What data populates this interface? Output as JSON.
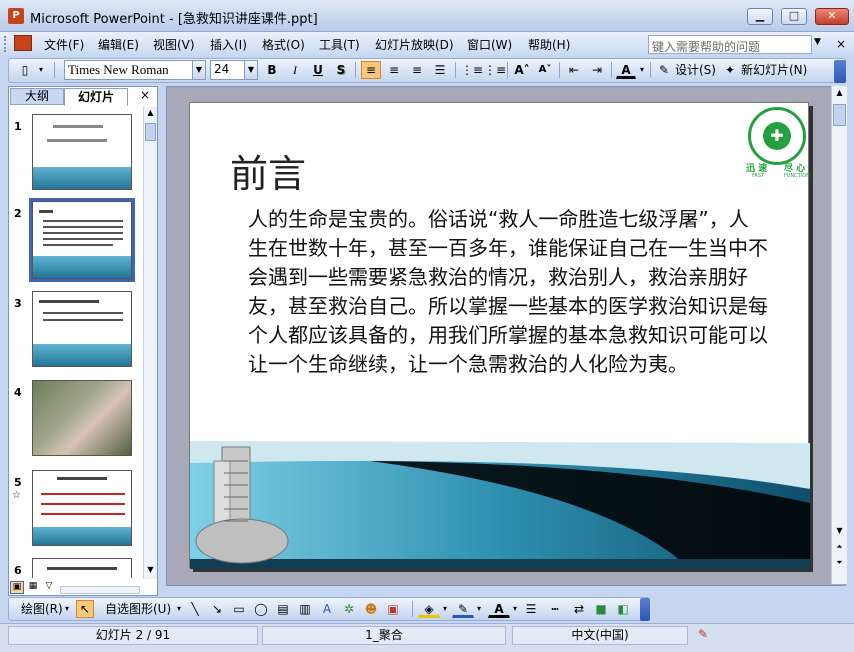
{
  "window": {
    "title": "Microsoft PowerPoint - [急救知识讲座课件.ppt]",
    "min": "▁",
    "max": "□",
    "close": "✕"
  },
  "menu": {
    "items": [
      "文件(F)",
      "编辑(E)",
      "视图(V)",
      "插入(I)",
      "格式(O)",
      "工具(T)",
      "幻灯片放映(D)",
      "窗口(W)",
      "帮助(H)"
    ],
    "help_placeholder": "键入需要帮助的问题"
  },
  "toolbar": {
    "font": "Times New Roman",
    "size": "24",
    "bold": "B",
    "italic": "I",
    "underline": "U",
    "shadow": "S",
    "design": "设计(S)",
    "new_slide": "新幻灯片(N)"
  },
  "pane": {
    "tab_outline": "大纲",
    "tab_slides": "幻灯片",
    "close": "×",
    "slide_numbers": [
      "1",
      "2",
      "3",
      "4",
      "5",
      "6"
    ]
  },
  "slide": {
    "title": "前言",
    "body": "人的生命是宝贵的。俗话说“救人一命胜造七级浮屠”，人生在世数十年，甚至一百多年，谁能保证自己在一生当中不会遇到一些需要紧急救治的情况，救治别人，救治亲朋好友，甚至救治自己。所以掌握一些基本的医学救治知识是每个人都应该具备的，用我们所掌握的基本急救知识可能可以让一个生命继续，让一个急需救治的人化险为夷。",
    "logo_left": "迅 速",
    "logo_right": "尽 心",
    "logo_sub_left": "FAST",
    "logo_sub_right": "FUNCTION"
  },
  "draw": {
    "draw_label": "绘图(R)",
    "autoshape": "自选图形(U)"
  },
  "status": {
    "slide_pos": "幻灯片 2 / 91",
    "design": "1_聚合",
    "lang": "中文(中国)"
  },
  "colors": {
    "accent_blue": "#3e63b7",
    "teal": "#2f8fb0"
  }
}
